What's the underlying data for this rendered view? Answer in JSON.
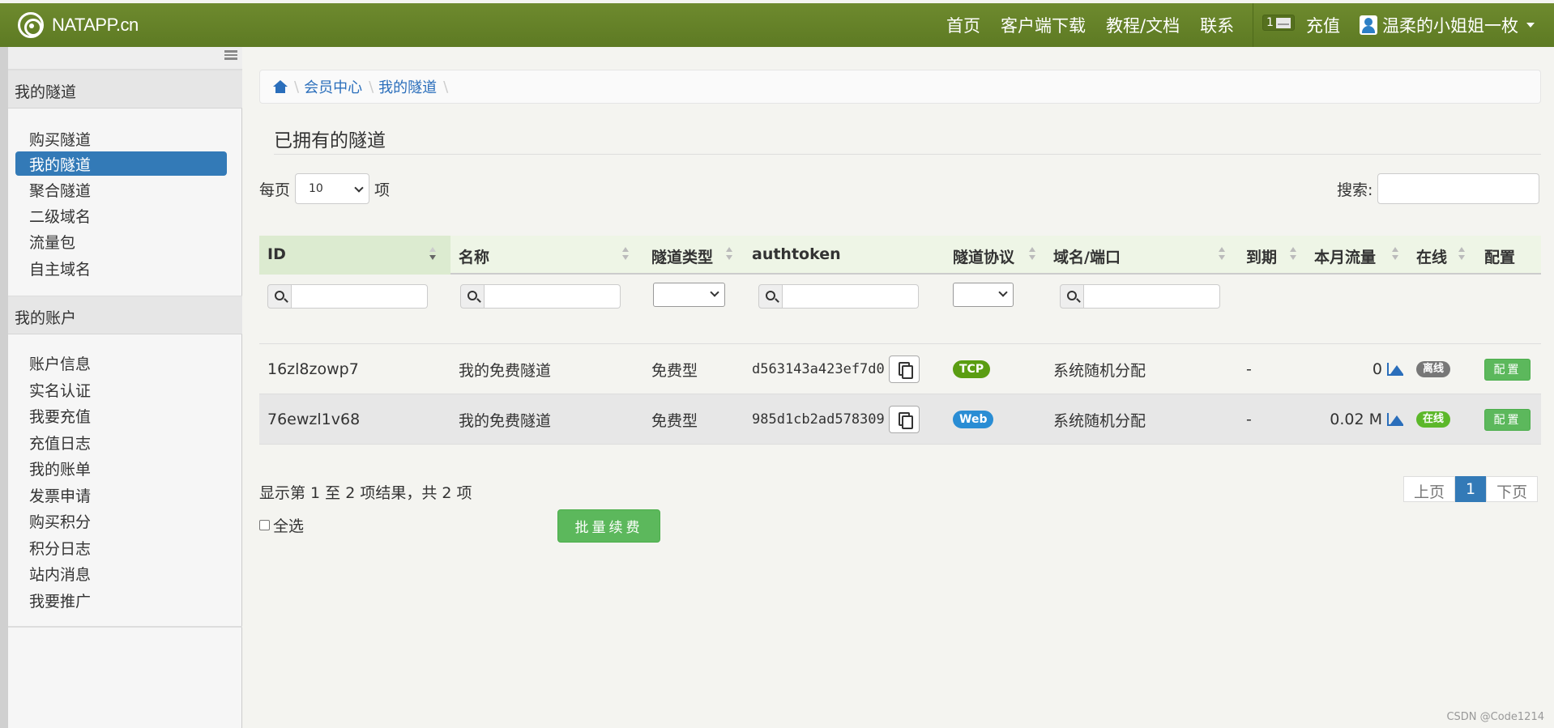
{
  "navbar": {
    "brand": "NATAPP.cn",
    "links": [
      "首页",
      "客户端下载",
      "教程/文档",
      "联系"
    ],
    "mail_count": "1",
    "charge": "充值",
    "user": "温柔的小姐姐一枚"
  },
  "sidebar": {
    "section1": "我的隧道",
    "tunnel_items": [
      "购买隧道",
      "我的隧道",
      "聚合隧道",
      "二级域名",
      "流量包",
      "自主域名"
    ],
    "section2": "我的账户",
    "account_items": [
      "账户信息",
      "实名认证",
      "我要充值",
      "充值日志",
      "我的账单",
      "发票申请",
      "购买积分",
      "积分日志",
      "站内消息",
      "我要推广"
    ]
  },
  "breadcrumb": [
    "会员中心",
    "我的隧道"
  ],
  "page_title": "已拥有的隧道",
  "controls": {
    "per_page_label": "每页",
    "per_page_value": "10",
    "per_page_unit": "项",
    "search_label": "搜索:"
  },
  "table": {
    "headers": [
      "ID",
      "名称",
      "隧道类型",
      "authtoken",
      "隧道协议",
      "域名/端口",
      "到期",
      "本月流量",
      "在线",
      "配置"
    ],
    "rows": [
      {
        "id": "16zl8zowp7",
        "name": "我的免费隧道",
        "type": "免费型",
        "token": "d563143a423ef7d0",
        "protocol": "TCP",
        "domain": "系统随机分配",
        "expire": "-",
        "traffic": "0",
        "status": "离线",
        "config": "配置"
      },
      {
        "id": "76ewzl1v68",
        "name": "我的免费隧道",
        "type": "免费型",
        "token": "985d1cb2ad578309",
        "protocol": "Web",
        "domain": "系统随机分配",
        "expire": "-",
        "traffic": "0.02 M",
        "status": "在线",
        "config": "配置"
      }
    ]
  },
  "footer": {
    "info": "显示第 1 至 2 项结果，共 2 项",
    "prev": "上页",
    "page": "1",
    "next": "下页",
    "select_all": "全选",
    "batch_renew": "批量续费"
  },
  "watermark": "CSDN @Code1214",
  "colors": {
    "navbar": "#5d7a23",
    "active": "#337ab7",
    "success": "#5cb85c",
    "tcp": "#5a9d12",
    "web": "#2a8dd4"
  }
}
